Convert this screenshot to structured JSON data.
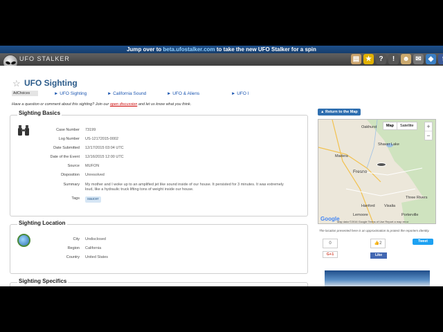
{
  "banner": {
    "pre": "Jump over to ",
    "link": "beta.ufostalker.com",
    "post": " to take the new UFO Stalker for a spin"
  },
  "header": {
    "brand": "UFO STALKER"
  },
  "toolbar": {
    "icons": [
      "book-icon",
      "star-icon",
      "help-icon",
      "info-icon",
      "alien-icon",
      "mail-icon",
      "cube-icon",
      "facebook-icon"
    ]
  },
  "page": {
    "title": "UFO Sighting"
  },
  "ads": {
    "adchoices": "AdChoices",
    "links": [
      "► UFO Sighting",
      "► California Sound",
      "► UFO & Aliens",
      "► UFO I"
    ]
  },
  "prompt": {
    "pre": "Have a question or comment about this sighting? Join our ",
    "link": "open discussion",
    "post": " and let us know what you think."
  },
  "basics": {
    "title": "Sighting Basics",
    "rows": [
      {
        "label": "Case Number",
        "value": "73199"
      },
      {
        "label": "Log Number",
        "value": "US-12172015-0002"
      },
      {
        "label": "Date Submitted",
        "value": "12/17/2015 03:04 UTC"
      },
      {
        "label": "Date of the Event",
        "value": "12/16/2015 12:00 UTC"
      },
      {
        "label": "Source",
        "value": "MUFON"
      },
      {
        "label": "Disposition",
        "value": "Unresolved"
      },
      {
        "label": "Summary",
        "value": "My mother and I woke up to an amplified jet like sound inside of our house. It persisted for 3 minutes. It was extremely loud, like a hydraulic truck lifting tons of weight inside our house."
      },
      {
        "label": "Tags",
        "value": "saucer"
      }
    ]
  },
  "location": {
    "title": "Sighting Location",
    "rows": [
      {
        "label": "City",
        "value": "Undisclosed"
      },
      {
        "label": "Region",
        "value": "California"
      },
      {
        "label": "Country",
        "value": "United States"
      }
    ]
  },
  "specifics": {
    "title": "Sighting Specifics"
  },
  "sidebar": {
    "return_map": "Return to the Map",
    "map_type": [
      "Map",
      "Satellite"
    ],
    "zoom": [
      "+",
      "−"
    ],
    "map_labels": [
      "Oakhurst",
      "Shaver Lake",
      "Madera",
      "Fresno",
      "Hanford",
      "Visalia",
      "Lemoore",
      "Three Rivers",
      "Porterville"
    ],
    "google": "Google",
    "attribution": "Map data ©2016 Google   Terms of Use   Report a map error",
    "note": "The location presented here is an approximation to protect the reporters identity.",
    "share_count": "0",
    "gplus": "G+1",
    "like_count": "2",
    "fb_like": "Like",
    "tweet": "Tweet"
  }
}
